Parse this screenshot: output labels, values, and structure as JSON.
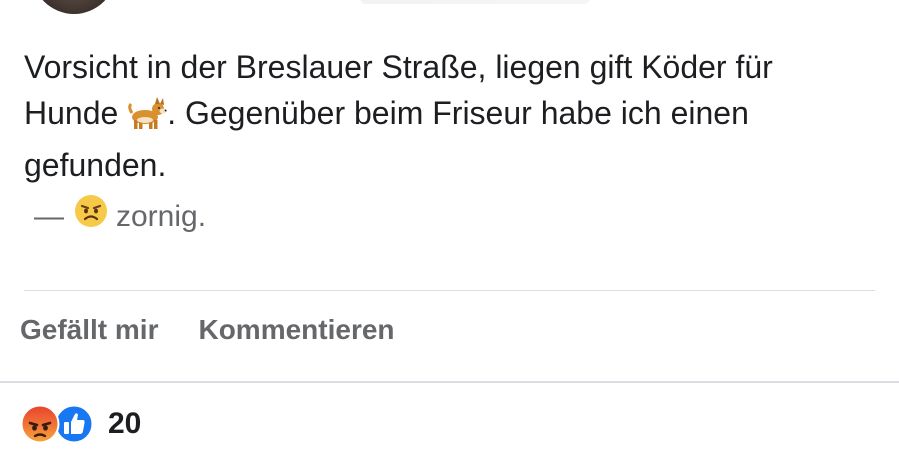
{
  "post": {
    "text_line1": "Vorsicht in der Breslauer Straße, liegen gift Köder für",
    "text_line2_a": "Hunde ",
    "text_line2_b": ". Gegenüber beim Friseur habe ich einen",
    "text_line3": "gefunden.",
    "feeling_dash": "—",
    "feeling_label": "zornig."
  },
  "actions": {
    "like_label": "Gefällt mir",
    "comment_label": "Kommentieren"
  },
  "reactions": {
    "count": "20",
    "types": [
      "angry",
      "like"
    ]
  },
  "icons": {
    "dog": "dog-emoji",
    "angry_face": "angry-face-emoji",
    "angry_reaction": "angry-reaction-icon",
    "like_reaction": "like-reaction-icon"
  },
  "colors": {
    "text": "#1c1e21",
    "muted": "#65676b",
    "like_blue": "#1877f2",
    "angry_orange": "#f0602e",
    "divider": "#dadde1"
  }
}
